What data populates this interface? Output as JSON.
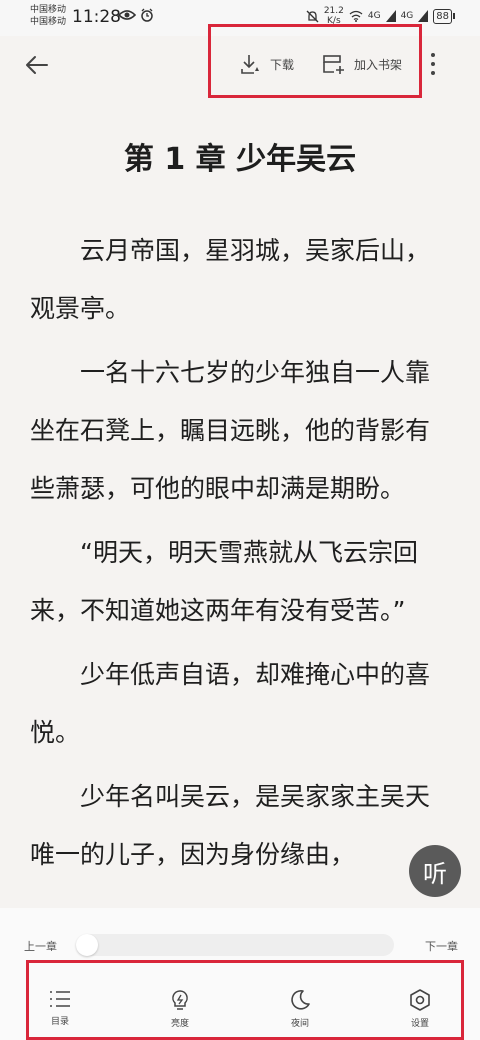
{
  "status_bar": {
    "carrier1": "中国移动",
    "carrier2": "中国移动",
    "time": "11:28",
    "speed_value": "21.2",
    "speed_unit": "K/s",
    "signal1": "4G",
    "signal2": "4G",
    "battery": "88"
  },
  "toolbar": {
    "download_label": "下载",
    "add_shelf_label": "加入书架"
  },
  "chapter": {
    "title": "第 1 章  少年吴云",
    "paragraphs": [
      "云月帝国，星羽城，吴家后山，观景亭。",
      "一名十六七岁的少年独自一人靠坐在石凳上，瞩目远眺，他的背影有些萧瑟，可他的眼中却满是期盼。",
      "“明天，明天雪燕就从飞云宗回来，不知道她这两年有没有受苦。”",
      "少年低声自语，却难掩心中的喜悦。",
      "少年名叫吴云，是吴家家主吴天唯一的儿子，因为身份缘由，"
    ]
  },
  "listen_label": "听",
  "progress": {
    "prev_label": "上一章",
    "next_label": "下一章",
    "value": 0
  },
  "bottom_nav": {
    "toc": "目录",
    "brightness": "亮度",
    "night": "夜间",
    "settings": "设置"
  },
  "colors": {
    "highlight": "#d9263a",
    "background": "#f5f3f1"
  }
}
